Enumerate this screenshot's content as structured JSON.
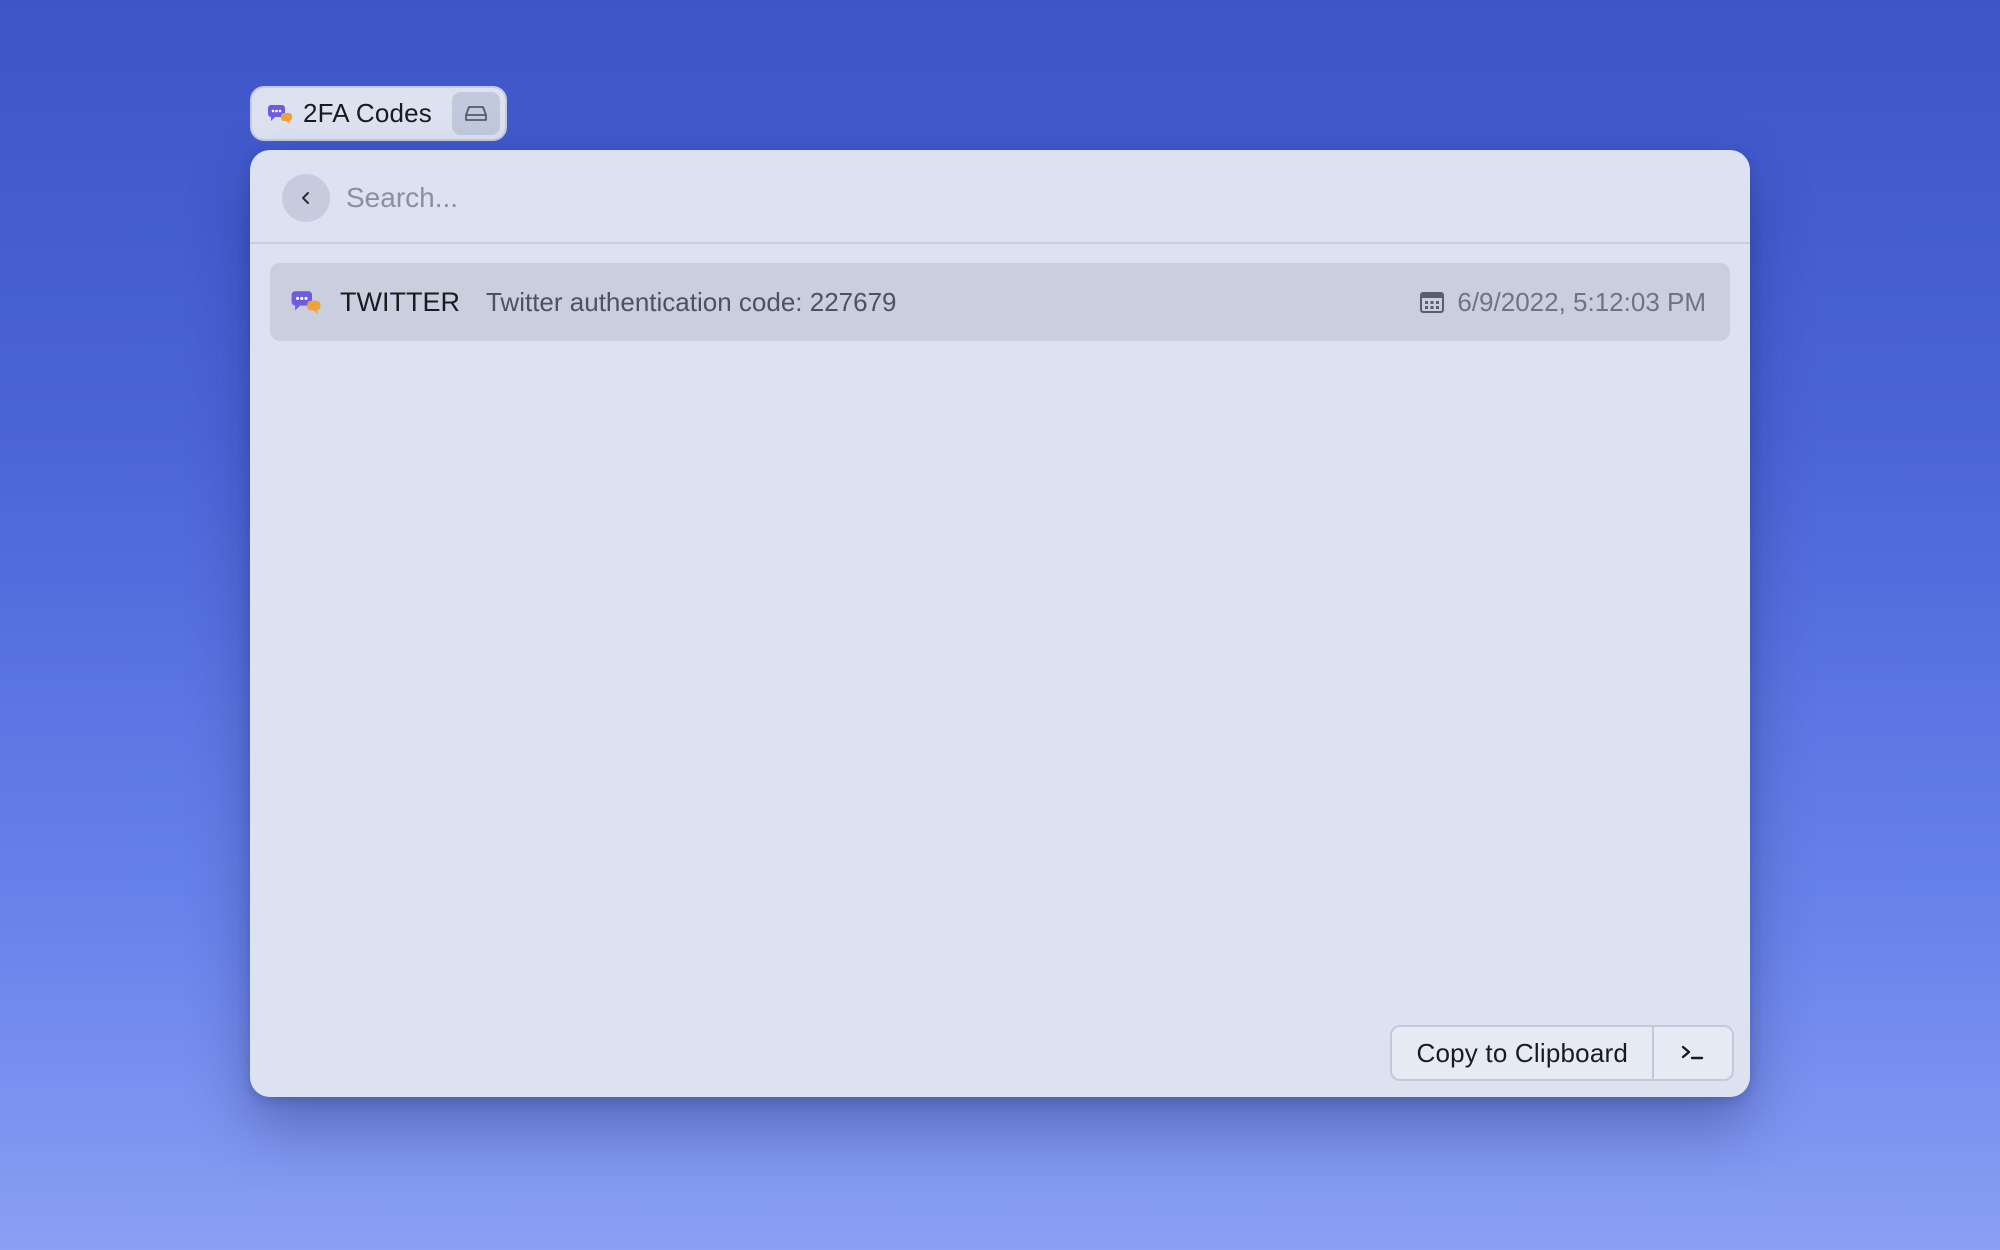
{
  "extension": {
    "title": "2FA Codes",
    "icon": "chat-bubbles-icon",
    "action_icon": "drive-icon"
  },
  "search": {
    "placeholder": "Search...",
    "value": "",
    "back_icon": "chevron-left-icon"
  },
  "list": {
    "items": [
      {
        "icon": "chat-bubbles-icon",
        "title": "TWITTER",
        "subtitle": "Twitter authentication code: 227679",
        "accessory_icon": "calendar-icon",
        "date": "6/9/2022, 5:12:03 PM",
        "selected": true
      }
    ]
  },
  "actions": {
    "primary_label": "Copy to Clipboard",
    "menu_icon": "terminal-icon"
  },
  "colors": {
    "background_top": "#3d55c6",
    "background_bottom": "#8aa0f4",
    "window": "#dde2f1",
    "selected_row": "#c9cfde",
    "icon_purple": "#6e5be0",
    "icon_orange": "#f0a23a"
  }
}
